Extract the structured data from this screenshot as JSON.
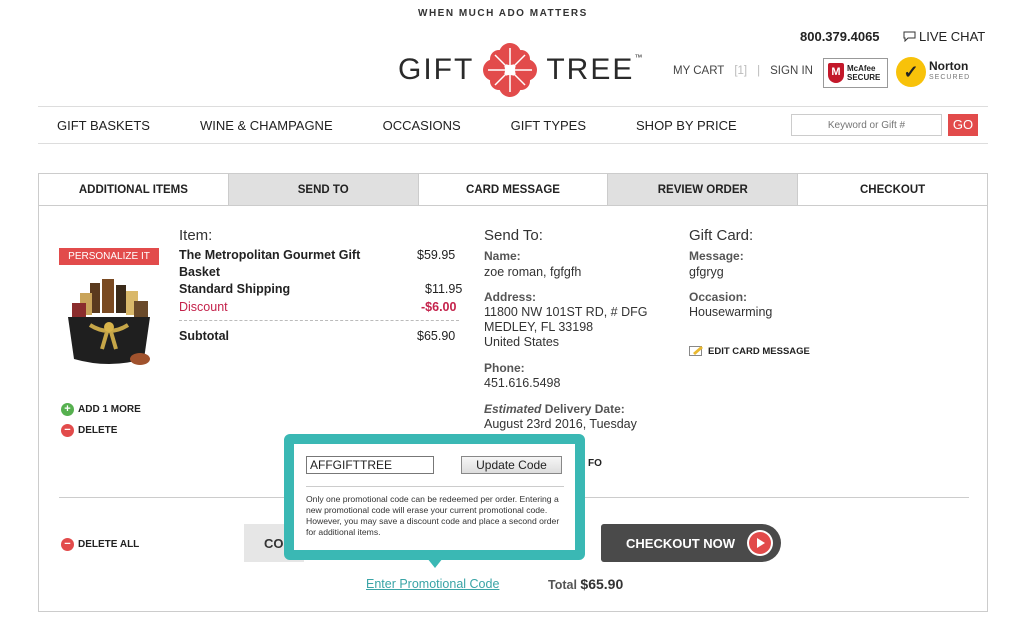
{
  "header": {
    "tagline": "WHEN MUCH ADO MATTERS",
    "logo_left": "GIFT",
    "logo_right": "TREE",
    "logo_tm": "™",
    "phone": "800.379.4065",
    "live_chat": "LIVE CHAT",
    "my_cart": "MY CART",
    "cart_count": "[1]",
    "sign_in": "SIGN IN",
    "mcafee_line1": "McAfee",
    "mcafee_line2": "SECURE",
    "norton_name": "Norton",
    "norton_sub": "SECURED"
  },
  "nav": {
    "items": [
      "GIFT BASKETS",
      "WINE & CHAMPAGNE",
      "OCCASIONS",
      "GIFT TYPES",
      "SHOP BY PRICE"
    ],
    "search_placeholder": "Keyword or Gift #",
    "go": "GO"
  },
  "tabs": [
    "ADDITIONAL ITEMS",
    "SEND TO",
    "CARD MESSAGE",
    "REVIEW ORDER",
    "CHECKOUT"
  ],
  "item": {
    "personalize": "PERSONALIZE IT",
    "title": "Item:",
    "name_line1": "The Metropolitan Gourmet Gift",
    "name_line2": "Basket",
    "price": "$59.95",
    "shipping_label": "Standard Shipping",
    "shipping_price": "$11.95",
    "discount_label": "Discount",
    "discount_value": "-$6.00",
    "subtotal_label": "Subtotal",
    "subtotal_value": "$65.90",
    "add_more": "ADD 1 MORE",
    "delete": "DELETE",
    "delete_all": "DELETE ALL"
  },
  "send_to": {
    "title": "Send To:",
    "name_label": "Name:",
    "name": "zoe roman, fgfgfh",
    "address_label": "Address:",
    "address1": "11800 NW 101ST RD, # DFG",
    "address2": "MEDLEY, FL 33198",
    "address3": "United States",
    "phone_label": "Phone:",
    "phone": "451.616.5498",
    "delivery_label_em": "Estimated",
    "delivery_label": " Delivery Date:",
    "delivery_date": "August 23rd 2016, Tuesday",
    "info_fragment": "FO"
  },
  "gift_card": {
    "title": "Gift Card:",
    "message_label": "Message:",
    "message": "gfgryg",
    "occasion_label": "Occasion:",
    "occasion": "Housewarming",
    "edit": "EDIT CARD MESSAGE"
  },
  "bottom": {
    "continue_fragment": "CO",
    "checkout": "CHECKOUT NOW",
    "promo_link": "Enter Promotional Code",
    "total_label": "Total",
    "total_value": "$65.90"
  },
  "popup": {
    "code_value": "AFFGIFTTREE",
    "update": "Update Code",
    "note": "Only one promotional code can be redeemed per order. Entering a new promotional code will erase your current promotional code. However, you may save a discount code and place a second order for additional items."
  },
  "colors": {
    "accent_red": "#e24b4b",
    "teal": "#3ab8b4",
    "discount_red": "#c4224b"
  }
}
